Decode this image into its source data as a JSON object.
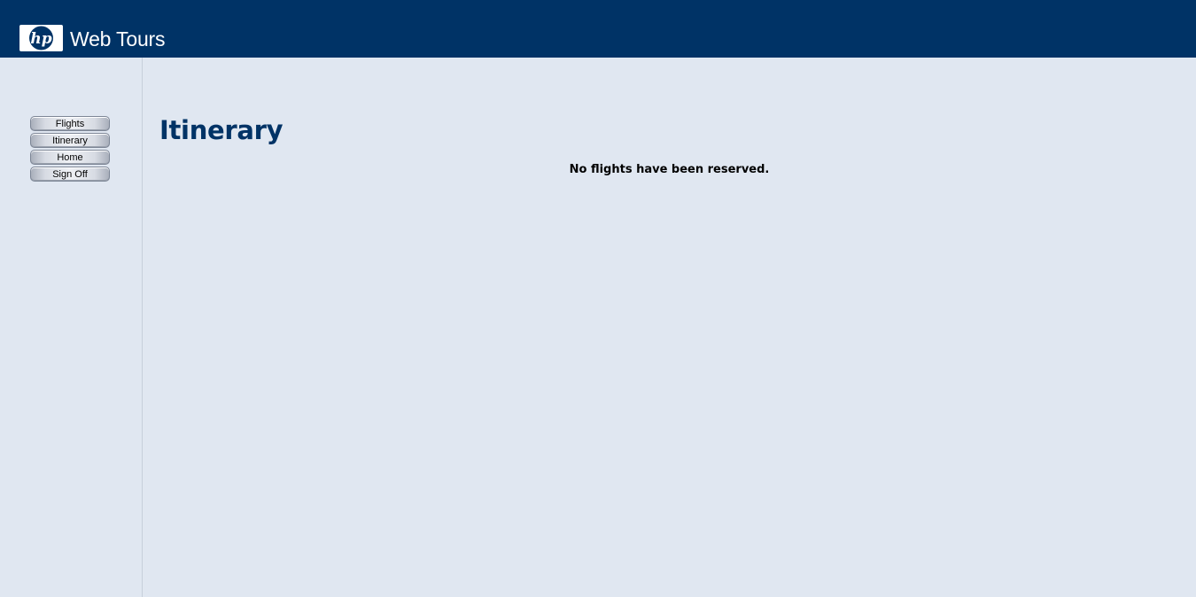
{
  "header": {
    "logo_icon": "hp-logo-icon",
    "brand_text": "Web Tours",
    "background_color": "#003366"
  },
  "sidebar": {
    "nav": [
      {
        "label": "Flights"
      },
      {
        "label": "Itinerary"
      },
      {
        "label": "Home"
      },
      {
        "label": "Sign Off"
      }
    ]
  },
  "main": {
    "title": "Itinerary",
    "message": "No flights have been reserved.",
    "title_color": "#003366",
    "background_color": "#e0e7f1"
  }
}
